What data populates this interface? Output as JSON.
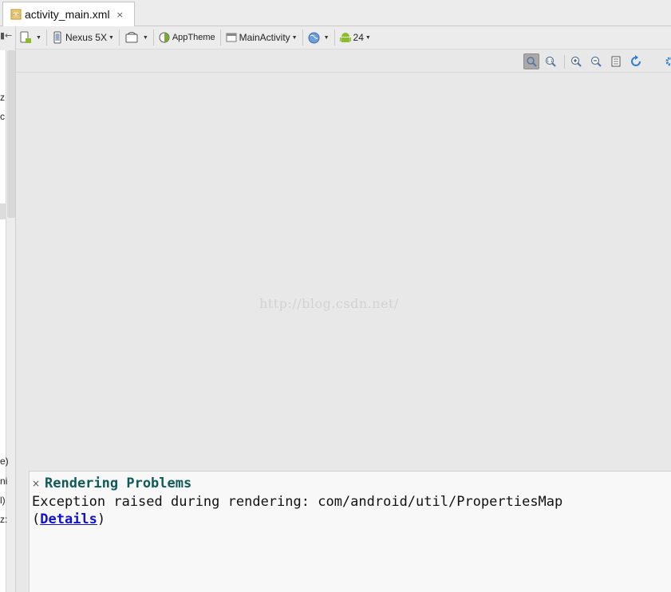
{
  "tab": {
    "title": "activity_main.xml",
    "close": "×"
  },
  "gutter": {
    "arrow": "▮←",
    "fragments": [
      "z",
      "c",
      "e)",
      "ni",
      "l)",
      "z:"
    ]
  },
  "toolbar": {
    "device": "Nexus 5X",
    "theme": "AppTheme",
    "activity": "MainActivity",
    "api": "24"
  },
  "canvas": {
    "watermark": "http://blog.csdn.net/"
  },
  "problems": {
    "close": "×",
    "title": "Rendering Problems",
    "message": "Exception raised during rendering: com/android/util/PropertiesMap",
    "details_open": "(",
    "details_link": "Details",
    "details_close": ")"
  },
  "colors": {
    "problem_title": "#115a5a",
    "link": "#1010d0",
    "android_green": "#8cbc2c",
    "sync_blue": "#2a7fd0"
  }
}
